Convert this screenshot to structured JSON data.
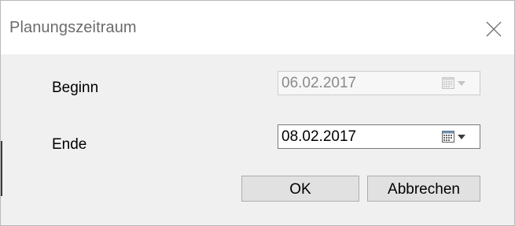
{
  "window": {
    "title": "Planungszeitraum",
    "close_icon": "close-icon"
  },
  "form": {
    "beginn": {
      "label": "Beginn",
      "value": "06.02.2017",
      "enabled": false,
      "icon": "calendar-icon"
    },
    "ende": {
      "label": "Ende",
      "value": "08.02.2017",
      "enabled": true,
      "icon": "calendar-icon"
    }
  },
  "buttons": {
    "ok_label": "OK",
    "cancel_label": "Abbrechen"
  },
  "colors": {
    "titlebar_bg": "#ffffff",
    "dialog_bg": "#f0f0f0",
    "button_bg": "#e1e1e1",
    "disabled_text": "#8a8a8a"
  }
}
